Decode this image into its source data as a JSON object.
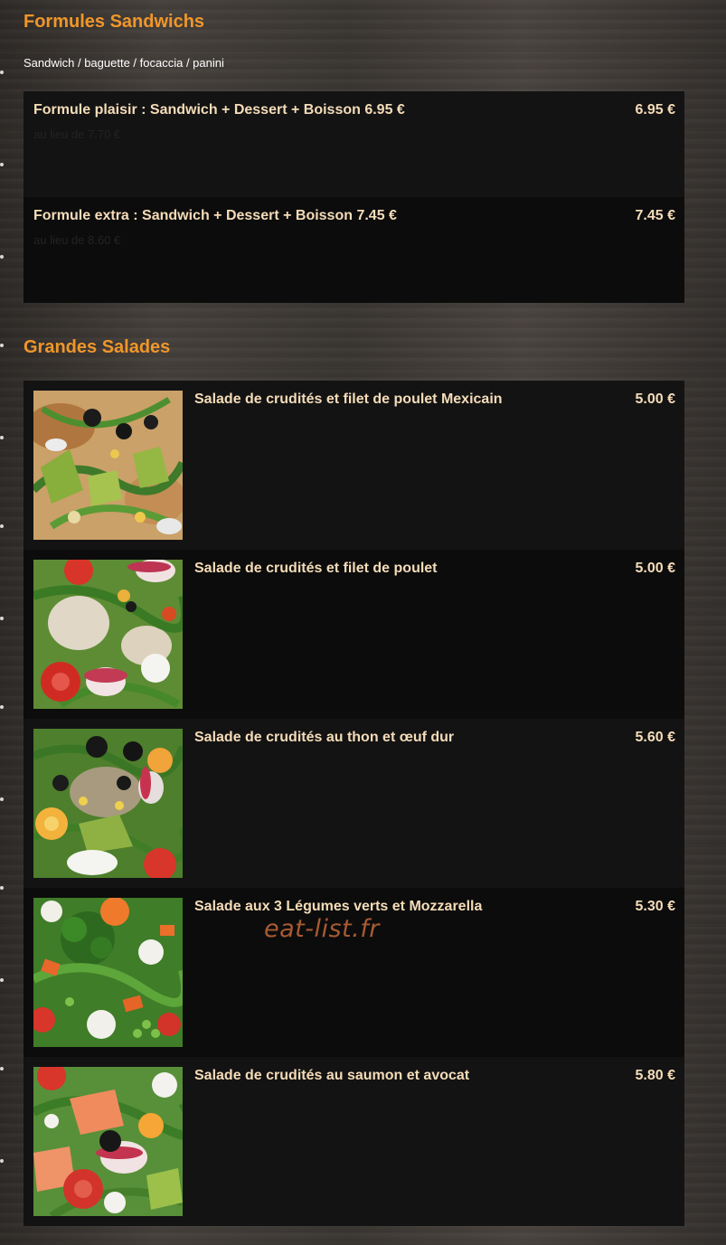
{
  "sections": [
    {
      "title": "Formules Sandwichs",
      "subtitle": "Sandwich / baguette / focaccia / panini",
      "items": [
        {
          "name": "Formule plaisir : Sandwich + Dessert + Boisson 6.95 €",
          "price": "6.95 €",
          "note": "au lieu de 7.70 €"
        },
        {
          "name": "Formule extra : Sandwich + Dessert + Boisson 7.45 €",
          "price": "7.45 €",
          "note": "au lieu de 8.60 €"
        }
      ]
    },
    {
      "title": "Grandes Salades",
      "items": [
        {
          "name": "Salade de crudités et filet de poulet Mexicain",
          "price": "5.00 €",
          "image": "salad-photo"
        },
        {
          "name": "Salade de crudités et filet de poulet",
          "price": "5.00 €",
          "image": "salad-photo"
        },
        {
          "name": "Salade de crudités au thon et œuf dur",
          "price": "5.60 €",
          "image": "salad-photo"
        },
        {
          "name": "Salade aux 3 Légumes verts et Mozzarella",
          "price": "5.30 €",
          "image": "salad-photo"
        },
        {
          "name": "Salade de crudités au saumon et avocat",
          "price": "5.80 €",
          "image": "salad-photo"
        }
      ]
    }
  ],
  "watermark": "eat-list.fr",
  "colors": {
    "section_title": "#f0962a",
    "item_text": "#f5dcb8",
    "row_dark": "#0c0c0c",
    "row_light": "#131313"
  }
}
